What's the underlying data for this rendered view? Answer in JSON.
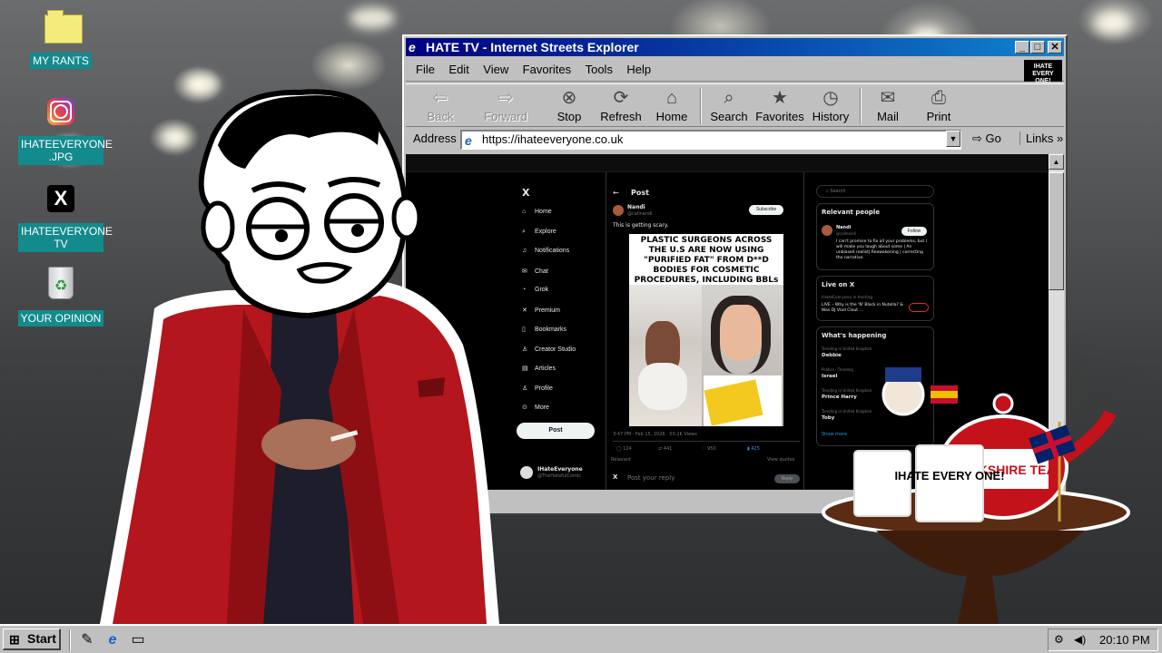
{
  "desktop": {
    "icons": [
      {
        "label": "MY RANTS",
        "icon": "folder-icon"
      },
      {
        "label": "IHATEEVERYONE\n.JPG",
        "icon": "instagram-icon"
      },
      {
        "label": "IHATEEVERYONE\nTV",
        "icon": "x-logo-icon"
      },
      {
        "label": "YOUR OPINION",
        "icon": "recycle-bin-icon"
      }
    ]
  },
  "window": {
    "title": "HATE TV - Internet Streets Explorer",
    "menu": [
      "File",
      "Edit",
      "View",
      "Favorites",
      "Tools",
      "Help"
    ],
    "logo_text": "IHATE EVERY ONE!",
    "toolbar": [
      {
        "label": "Back",
        "icon": "back-arrow-icon",
        "disabled": true
      },
      {
        "label": "Forward",
        "icon": "forward-arrow-icon",
        "disabled": true
      },
      {
        "label": "Stop",
        "icon": "stop-icon"
      },
      {
        "label": "Refresh",
        "icon": "refresh-icon"
      },
      {
        "label": "Home",
        "icon": "home-icon"
      },
      {
        "label": "Search",
        "icon": "search-icon"
      },
      {
        "label": "Favorites",
        "icon": "favorites-icon"
      },
      {
        "label": "History",
        "icon": "history-icon"
      },
      {
        "label": "Mail",
        "icon": "mail-icon"
      },
      {
        "label": "Print",
        "icon": "print-icon"
      }
    ],
    "address_label": "Address",
    "address_url": "https://ihateeveryone.co.uk",
    "go_label": "Go",
    "links_label": "Links"
  },
  "x_page": {
    "nav": [
      "Home",
      "Explore",
      "Notifications",
      "Chat",
      "Grok",
      "Premium",
      "Bookmarks",
      "Creator Studio",
      "Articles",
      "Profile",
      "More"
    ],
    "post_button": "Post",
    "account_name": "IHateEveryone",
    "account_handle": "@TheHatefulComic",
    "header": "Post",
    "author_name": "Nandi",
    "author_handle": "@callnandi",
    "subscribe": "Subscribe",
    "tweet_text": "This is getting scary.",
    "meme_caption": "PLASTIC SURGEONS ACROSS THE U.S ARE NOW USING \"PURIFIED FAT\" FROM D**D BODIES FOR COSMETIC PROCEDURES, INCLUDING BBLs",
    "meta": "3:47 PM · Feb 15, 2026 · 50.2K Views",
    "stats": {
      "replies": "124",
      "reposts": "441",
      "likes": "950",
      "bookmarks": "425"
    },
    "relevant_label": "Relevant",
    "view_quotes": "View quotes",
    "reply_placeholder": "Post your reply",
    "reply_button": "Reply",
    "search_placeholder": "Search",
    "relevant_people": "Relevant people",
    "follow": "Follow",
    "bio": "I can't promise to fix all your problems, but I will make you laugh about some | An unbiased realist| Reawakening | correcting the narrative.",
    "live_title": "Live on X",
    "live_host": "IHateEveryone is hosting",
    "live_text": "LIVE – Why is the 'N' Black in Nutella? & Was DJ Vlad Clout ...",
    "whats_happening": "What's happening",
    "trends": [
      {
        "context": "Trending in United Kingdom",
        "name": "Debbie"
      },
      {
        "context": "Politics · Trending",
        "name": "Israel"
      },
      {
        "context": "Trending in United Kingdom",
        "name": "Prince Harry"
      },
      {
        "context": "Trending in United Kingdom",
        "name": "Toby"
      }
    ],
    "show_more": "Show more"
  },
  "taskbar": {
    "start_label": "Start",
    "clock": "20:10 PM"
  },
  "props": {
    "mug_text": "IHATE EVERY ONE!",
    "teapot_text": "YORKSHIRE TEA"
  }
}
